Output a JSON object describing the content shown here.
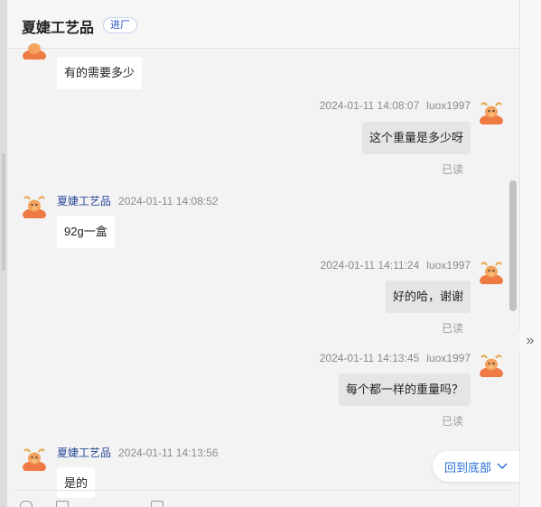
{
  "header": {
    "shop_name": "夏婕工艺品",
    "badge": "进厂"
  },
  "messages": [
    {
      "side": "left",
      "text": "有的需要多少"
    },
    {
      "side": "right",
      "time": "2024-01-11 14:08:07",
      "user": "luox1997",
      "text": "这个重量是多少呀",
      "status": "已读"
    },
    {
      "side": "left",
      "user": "夏婕工艺品",
      "time": "2024-01-11 14:08:52",
      "text": "92g一盒"
    },
    {
      "side": "right",
      "time": "2024-01-11 14:11:24",
      "user": "luox1997",
      "text": "好的哈，谢谢",
      "status": "已读"
    },
    {
      "side": "right",
      "time": "2024-01-11 14:13:45",
      "user": "luox1997",
      "text": "每个都一样的重量吗？",
      "status": "已读"
    },
    {
      "side": "left",
      "user": "夏婕工艺品",
      "time": "2024-01-11 14:13:56",
      "text": "是的"
    }
  ],
  "back_to_bottom": "回到底部",
  "colors": {
    "accent": "#2a6fd6",
    "avatar_orange": "#f07a44"
  },
  "icons": {
    "avatar": "cow-avatar-icon",
    "collapse": "double-chevron-right-icon",
    "chevron": "chevron-down-icon"
  }
}
